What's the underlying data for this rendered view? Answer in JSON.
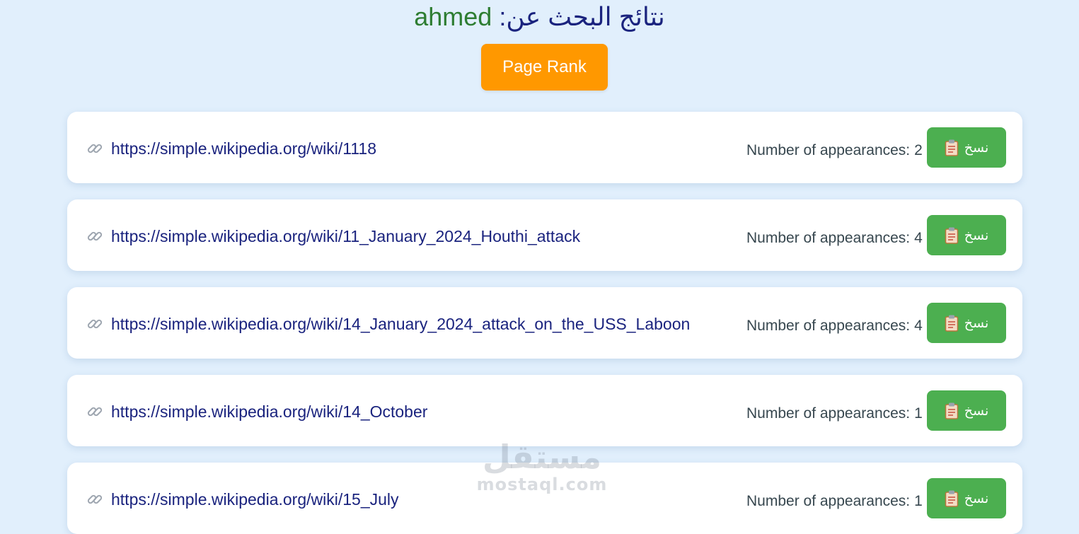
{
  "header": {
    "query": "ahmed",
    "prefix": ":نتائج البحث عن"
  },
  "rank_button": {
    "label": "Page Rank"
  },
  "results": [
    {
      "url": "https://simple.wikipedia.org/wiki/1118",
      "count_label": "Number of appearances:",
      "count": "2",
      "copy_label": "نسخ"
    },
    {
      "url": "https://simple.wikipedia.org/wiki/11_January_2024_Houthi_attack",
      "count_label": "Number of appearances:",
      "count": "4",
      "copy_label": "نسخ"
    },
    {
      "url": "https://simple.wikipedia.org/wiki/14_January_2024_attack_on_the_USS_Laboon",
      "count_label": "Number of appearances:",
      "count": "4",
      "copy_label": "نسخ"
    },
    {
      "url": "https://simple.wikipedia.org/wiki/14_October",
      "count_label": "Number of appearances:",
      "count": "1",
      "copy_label": "نسخ"
    },
    {
      "url": "https://simple.wikipedia.org/wiki/15_July",
      "count_label": "Number of appearances:",
      "count": "1",
      "copy_label": "نسخ"
    }
  ],
  "icons": {
    "link": "link-icon",
    "copy": "clipboard-icon"
  },
  "colors": {
    "background": "#e1effc",
    "query": "#2e7d32",
    "heading": "#1a237e",
    "rank_button": "#ff9800",
    "copy_button": "#4caf50",
    "url": "#1a237e"
  },
  "watermark": {
    "arabic": "مستقل",
    "latin": "mostaql.com"
  }
}
